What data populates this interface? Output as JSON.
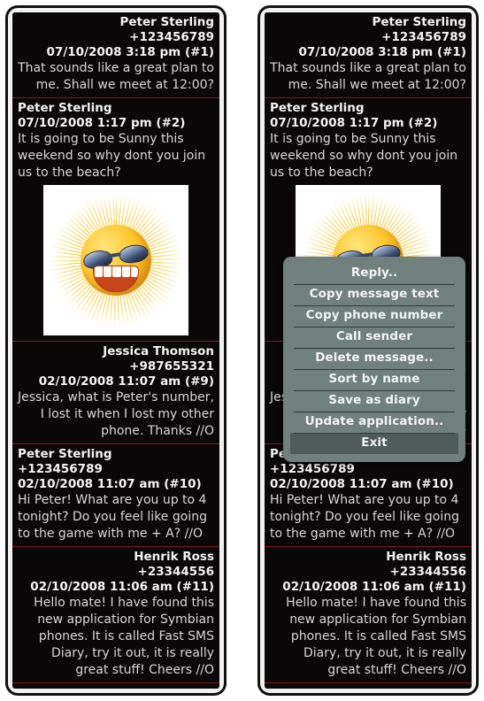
{
  "app": {
    "name": "Fast SMS Diary",
    "separator_color": "#7d1b1b",
    "screen_background": "#0a0708",
    "menu_background": "#6f807d",
    "menu_selected_background": "#4d5c59"
  },
  "messages": [
    {
      "align": "right",
      "sender": "Peter Sterling",
      "phone": "+123456789",
      "stamp": "07/10/2008   3:18 pm (#1)",
      "body": "That sounds like a great plan to me. Shall we meet at 12:00?",
      "attachment": ""
    },
    {
      "align": "left",
      "sender": "Peter Sterling",
      "phone": "",
      "stamp": "07/10/2008   1:17 pm (#2)",
      "body": "It is going to be Sunny this weekend so why dont you join us to the beach?",
      "attachment": "sun-with-sunglasses-image"
    },
    {
      "align": "right",
      "sender": "Jessica Thomson",
      "phone": "+987655321",
      "stamp": "02/10/2008   11:07 am (#9)",
      "body": "Jessica, what is Peter's number, I lost it when I lost my other phone. Thanks //O",
      "attachment": ""
    },
    {
      "align": "left",
      "sender": "Peter Sterling",
      "phone": "+123456789",
      "stamp": "02/10/2008   11:07 am (#10)",
      "body": "Hi Peter! What are you up to 4 tonight? Do you feel like going to the game with me + A? //O",
      "attachment": ""
    },
    {
      "align": "right",
      "sender": "Henrik Ross",
      "phone": "+23344556",
      "stamp": "02/10/2008   11:06 am (#11)",
      "body": "Hello mate! I have found this new application for Symbian phones. It is called Fast SMS Diary, try it out, it is really great stuff! Cheers //O",
      "attachment": ""
    }
  ],
  "context_menu": {
    "items": [
      {
        "label": "Reply..",
        "selected": false
      },
      {
        "label": "Copy message text",
        "selected": false
      },
      {
        "label": "Copy phone number",
        "selected": false
      },
      {
        "label": "Call sender",
        "selected": false
      },
      {
        "label": "Delete message..",
        "selected": false
      },
      {
        "label": "Sort by name",
        "selected": false
      },
      {
        "label": "Save as diary",
        "selected": false
      },
      {
        "label": "Update application..",
        "selected": false
      },
      {
        "label": "Exit",
        "selected": true
      }
    ]
  }
}
